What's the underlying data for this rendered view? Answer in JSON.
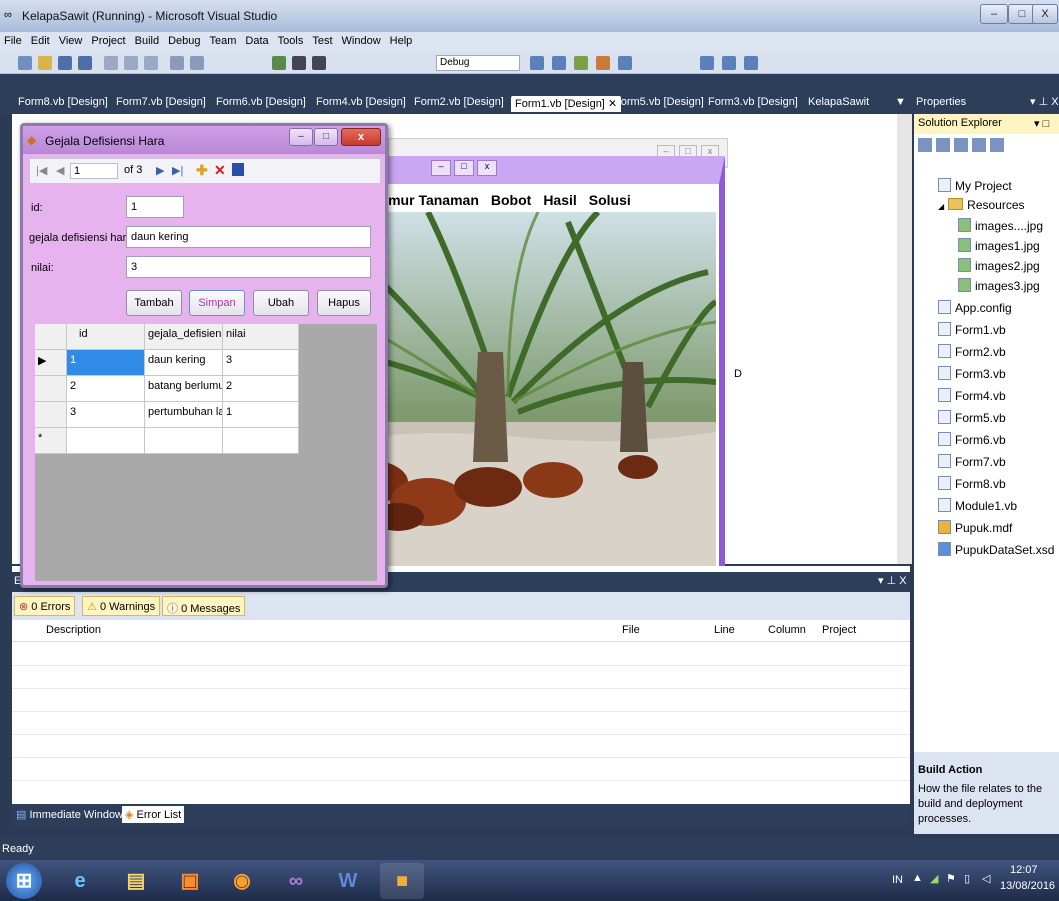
{
  "window": {
    "title": "KelapaSawit (Running) - Microsoft Visual Studio"
  },
  "menu": [
    "File",
    "Edit",
    "View",
    "Project",
    "Build",
    "Debug",
    "Team",
    "Data",
    "Tools",
    "Test",
    "Window",
    "Help"
  ],
  "toolbar": {
    "config": "Debug"
  },
  "doc_tabs": [
    {
      "label": "Form8.vb [Design]"
    },
    {
      "label": "Form7.vb [Design]"
    },
    {
      "label": "Form6.vb [Design]"
    },
    {
      "label": "Form4.vb [Design]"
    },
    {
      "label": "Form2.vb [Design]"
    },
    {
      "label": "Form1.vb [Design]"
    },
    {
      "label": "Form5.vb [Design]"
    },
    {
      "label": "Form3.vb [Design]"
    },
    {
      "label": "KelapaSawit"
    }
  ],
  "purple_menu": [
    "Umur Tanaman",
    "Bobot",
    "Hasil",
    "Solusi"
  ],
  "gejala": {
    "title": "Gejala Defisiensi Hara",
    "nav_position": "1",
    "nav_of": "of 3",
    "id_label": "id:",
    "id_value": "1",
    "gejala_label": "gejala defisiensi hara:",
    "gejala_value": "daun kering",
    "nilai_label": "nilai:",
    "nilai_value": "3",
    "buttons": {
      "tambah": "Tambah",
      "simpan": "Simpan",
      "ubah": "Ubah",
      "hapus": "Hapus"
    },
    "grid_headers": [
      "id",
      "gejala_defisiensi_h:",
      "nilai"
    ],
    "grid_rows": [
      {
        "id": "1",
        "gejala": "daun kering",
        "nilai": "3"
      },
      {
        "id": "2",
        "gejala": "batang berlumut",
        "nilai": "2"
      },
      {
        "id": "3",
        "gejala": "pertumbuhan lam...",
        "nilai": "1"
      }
    ],
    "new_row_marker": "*"
  },
  "error_list": {
    "header": "Er",
    "errors": "0 Errors",
    "warnings": "0 Warnings",
    "messages": "0 Messages",
    "columns": {
      "description": "Description",
      "file": "File",
      "line": "Line",
      "column": "Column",
      "project": "Project"
    }
  },
  "bottom_tabs": {
    "immediate": "Immediate Window",
    "errorlist": "Error List"
  },
  "properties": {
    "title": "Properties"
  },
  "solution_explorer": {
    "title": "Solution Explorer",
    "items": [
      "My Project",
      "Resources",
      "images....jpg",
      "images1.jpg",
      "images2.jpg",
      "images3.jpg",
      "App.config",
      "Form1.vb",
      "Form2.vb",
      "Form3.vb",
      "Form4.vb",
      "Form5.vb",
      "Form6.vb",
      "Form7.vb",
      "Form8.vb",
      "Module1.vb",
      "Pupuk.mdf",
      "PupukDataSet.xsd"
    ]
  },
  "build_action": {
    "title": "Build Action",
    "description": "How the file relates to the build and deployment processes."
  },
  "status": {
    "text": "Ready"
  },
  "taskbar": {
    "lang": "IN",
    "time": "12:07",
    "date": "13/08/2016"
  },
  "colors": {
    "vs_dark": "#2d3e5b",
    "form_pink": "#e7b3ef",
    "purple_border": "#8e5bd6"
  }
}
